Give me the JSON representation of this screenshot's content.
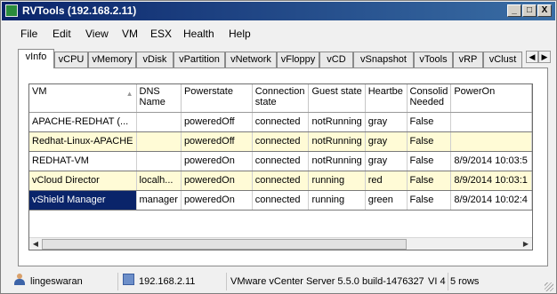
{
  "window": {
    "title": "RVTools (192.168.2.11)",
    "controls": {
      "minimize": "_",
      "maximize": "□",
      "close": "X"
    }
  },
  "menu": [
    "File",
    "Edit",
    "View",
    "VM",
    "ESX",
    "Health",
    "Help"
  ],
  "tabs": [
    "vInfo",
    "vCPU",
    "vMemory",
    "vDisk",
    "vPartition",
    "vNetwork",
    "vFloppy",
    "vCD",
    "vSnapshot",
    "vTools",
    "vRP",
    "vClust"
  ],
  "active_tab": "vInfo",
  "grid": {
    "headers": [
      "VM",
      "DNS Name",
      "Powerstate",
      "Connection state",
      "Guest state",
      "Heartbe",
      "Consolid Needed",
      "PowerOn"
    ],
    "rows": [
      [
        "APACHE-REDHAT (...",
        "",
        "poweredOff",
        "connected",
        "notRunning",
        "gray",
        "False",
        ""
      ],
      [
        "Redhat-Linux-APACHE",
        "",
        "poweredOff",
        "connected",
        "notRunning",
        "gray",
        "False",
        ""
      ],
      [
        "REDHAT-VM",
        "",
        "poweredOn",
        "connected",
        "notRunning",
        "gray",
        "False",
        "8/9/2014 10:03:5"
      ],
      [
        "vCloud Director",
        "localh...",
        "poweredOn",
        "connected",
        "running",
        "red",
        "False",
        "8/9/2014 10:03:1"
      ],
      [
        "vShield Manager",
        "manager",
        "poweredOn",
        "connected",
        "running",
        "green",
        "False",
        "8/9/2014 10:02:4"
      ]
    ],
    "selected_row": 4
  },
  "status": {
    "user": "lingeswaran",
    "server": "192.168.2.11",
    "version": "VMware vCenter Server 5.5.0 build-1476327",
    "version_suffix": "VI 4",
    "rows": "5 rows"
  },
  "colors": {
    "selection": "#0a246a",
    "alt_row": "#fffbd6",
    "titlebar": "#0a246a"
  }
}
